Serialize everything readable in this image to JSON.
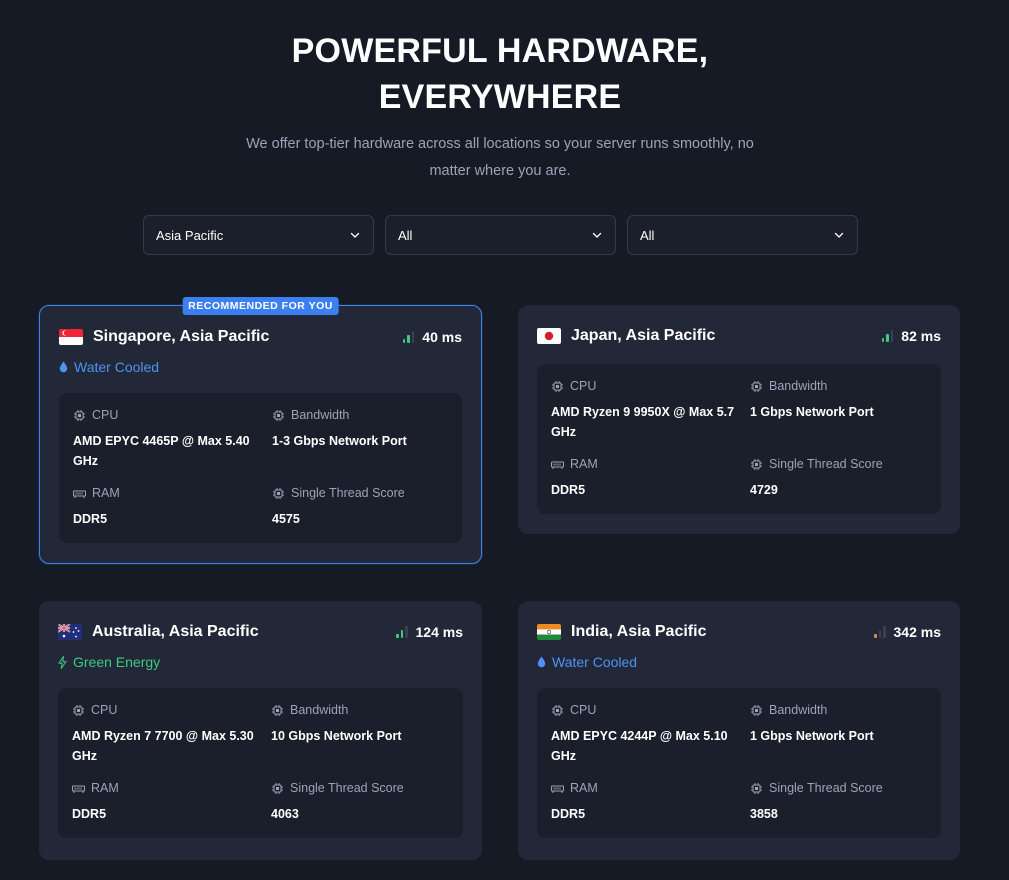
{
  "header": {
    "title_line1": "POWERFUL HARDWARE,",
    "title_line2": "EVERYWHERE",
    "subtitle": "We offer top-tier hardware across all locations so your server runs smoothly, no matter where you are."
  },
  "filters": {
    "region": "Asia Pacific",
    "filter2": "All",
    "filter3": "All"
  },
  "labels": {
    "cpu": "CPU",
    "bandwidth": "Bandwidth",
    "ram": "RAM",
    "single_thread": "Single Thread Score"
  },
  "colors": {
    "accent": "#3b7ff0",
    "water": "#4c93f3",
    "green": "#3ecb7d",
    "signal_good": "#3ecb7d",
    "signal_poor": "#e0873a"
  },
  "locations": [
    {
      "name": "Singapore, Asia Pacific",
      "flag": "singapore-flag",
      "ping": "40 ms",
      "signal": "good",
      "recommended": true,
      "badge": "RECOMMENDED FOR YOU",
      "feature": "Water Cooled",
      "feature_icon": "water-drop-icon",
      "cpu": "AMD EPYC 4465P @ Max 5.40 GHz",
      "bandwidth": "1-3 Gbps Network Port",
      "ram": "DDR5",
      "single_thread": "4575"
    },
    {
      "name": "Japan, Asia Pacific",
      "flag": "japan-flag",
      "ping": "82 ms",
      "signal": "good",
      "recommended": false,
      "feature": "",
      "cpu": "AMD Ryzen 9 9950X @ Max 5.7 GHz",
      "bandwidth": "1 Gbps Network Port",
      "ram": "DDR5",
      "single_thread": "4729"
    },
    {
      "name": "Australia, Asia Pacific",
      "flag": "australia-flag",
      "ping": "124 ms",
      "signal": "good",
      "recommended": false,
      "feature": "Green Energy",
      "feature_icon": "lightning-icon",
      "cpu": "AMD Ryzen 7 7700 @ Max 5.30 GHz",
      "bandwidth": "10 Gbps Network Port",
      "ram": "DDR5",
      "single_thread": "4063"
    },
    {
      "name": "India, Asia Pacific",
      "flag": "india-flag",
      "ping": "342 ms",
      "signal": "poor",
      "recommended": false,
      "feature": "Water Cooled",
      "feature_icon": "water-drop-icon",
      "cpu": "AMD EPYC 4244P @ Max 5.10 GHz",
      "bandwidth": "1 Gbps Network Port",
      "ram": "DDR5",
      "single_thread": "3858"
    }
  ]
}
